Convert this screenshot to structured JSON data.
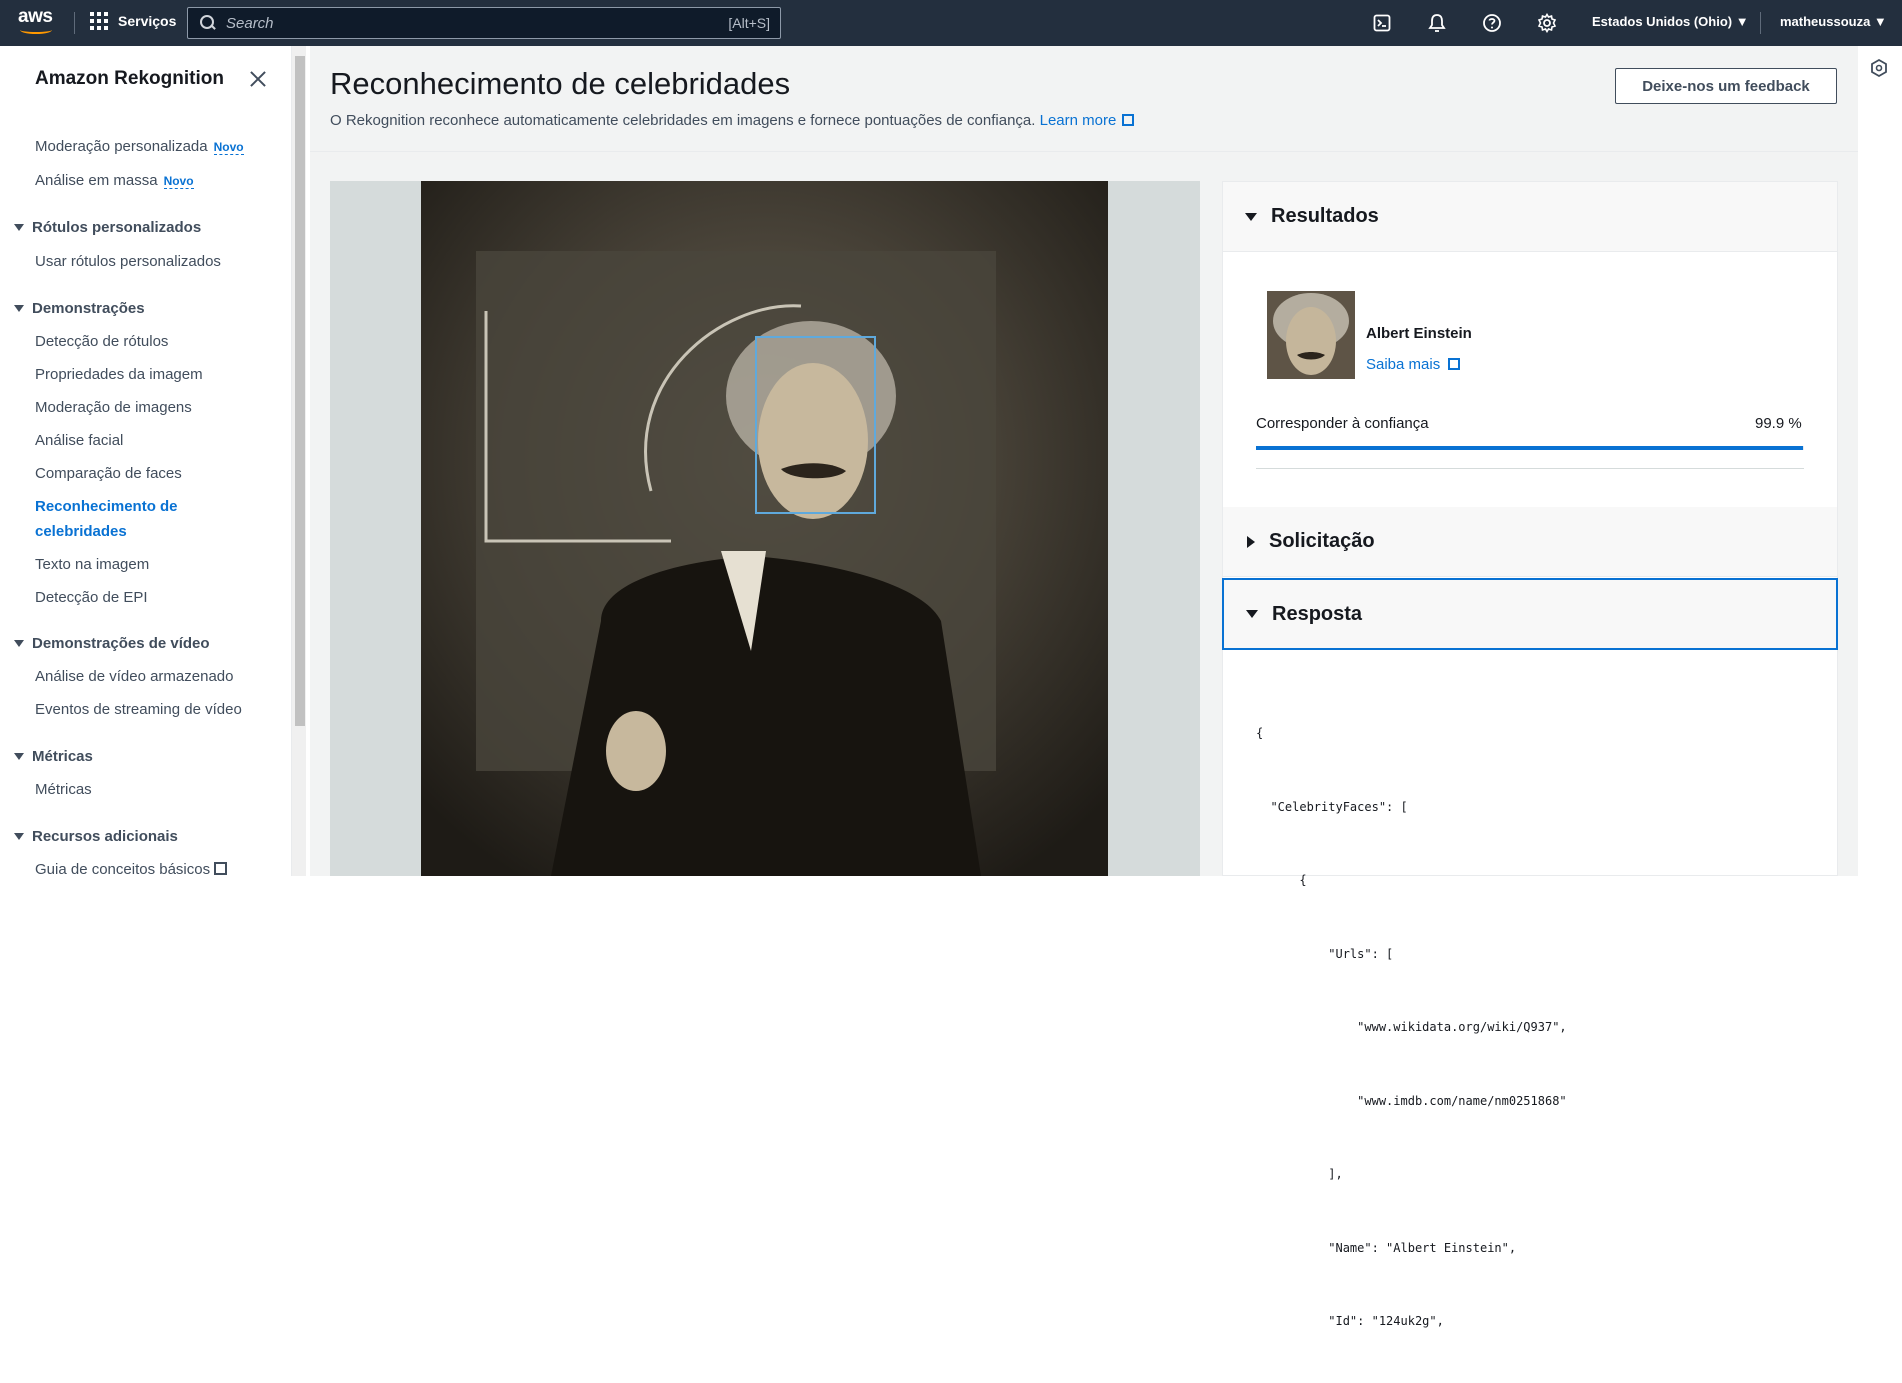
{
  "topnav": {
    "logo": "aws",
    "services_label": "Serviços",
    "search_placeholder": "Search",
    "search_shortcut": "[Alt+S]",
    "region": "Estados Unidos (Ohio) ▼",
    "user": "matheussouza ▼",
    "icons": [
      "cloudshell-icon",
      "notifications-icon",
      "help-icon",
      "settings-icon"
    ]
  },
  "sidebar": {
    "title": "Amazon Rekognition",
    "items": [
      {
        "label": "Moderação personalizada",
        "badge": "Novo"
      },
      {
        "label": "Análise em massa",
        "badge": "Novo"
      }
    ],
    "sections": [
      {
        "title": "Rótulos personalizados",
        "items": [
          "Usar rótulos personalizados"
        ]
      },
      {
        "title": "Demonstrações",
        "items": [
          "Detecção de rótulos",
          "Propriedades da imagem",
          "Moderação de imagens",
          "Análise facial",
          "Comparação de faces",
          "Reconhecimento de celebridades",
          "Texto na imagem",
          "Detecção de EPI"
        ]
      },
      {
        "title": "Demonstrações de vídeo",
        "items": [
          "Análise de vídeo armazenado",
          "Eventos de streaming de vídeo"
        ]
      },
      {
        "title": "Métricas",
        "items": [
          "Métricas"
        ]
      },
      {
        "title": "Recursos adicionais",
        "items": [
          "Guia de conceitos básicos"
        ]
      }
    ],
    "active_item": "Reconhecimento de celebridades"
  },
  "header": {
    "title": "Reconhecimento de celebridades",
    "description": "O Rekognition reconhece automaticamente celebridades em imagens e fornece pontuações de confiança.",
    "learn_more": "Learn more",
    "feedback_button": "Deixe-nos um feedback"
  },
  "results": {
    "title": "Resultados",
    "celebrity_name": "Albert Einstein",
    "learn_more": "Saiba mais",
    "confidence_label": "Corresponder à confiança",
    "confidence_value": "99.9 %",
    "confidence_fraction": 0.999
  },
  "request": {
    "title": "Solicitação"
  },
  "response": {
    "title": "Resposta",
    "json_lines": [
      "{",
      "  \"CelebrityFaces\": [",
      "      {",
      "          \"Urls\": [",
      "              \"www.wikidata.org/wiki/Q937\",",
      "              \"www.imdb.com/name/nm0251868\"",
      "          ],",
      "          \"Name\": \"Albert Einstein\",",
      "          \"Id\": \"124uk2g\","
    ]
  },
  "colors": {
    "nav_bg": "#232f3e",
    "accent": "#0972d3",
    "face_box": "#5fa9dc"
  }
}
